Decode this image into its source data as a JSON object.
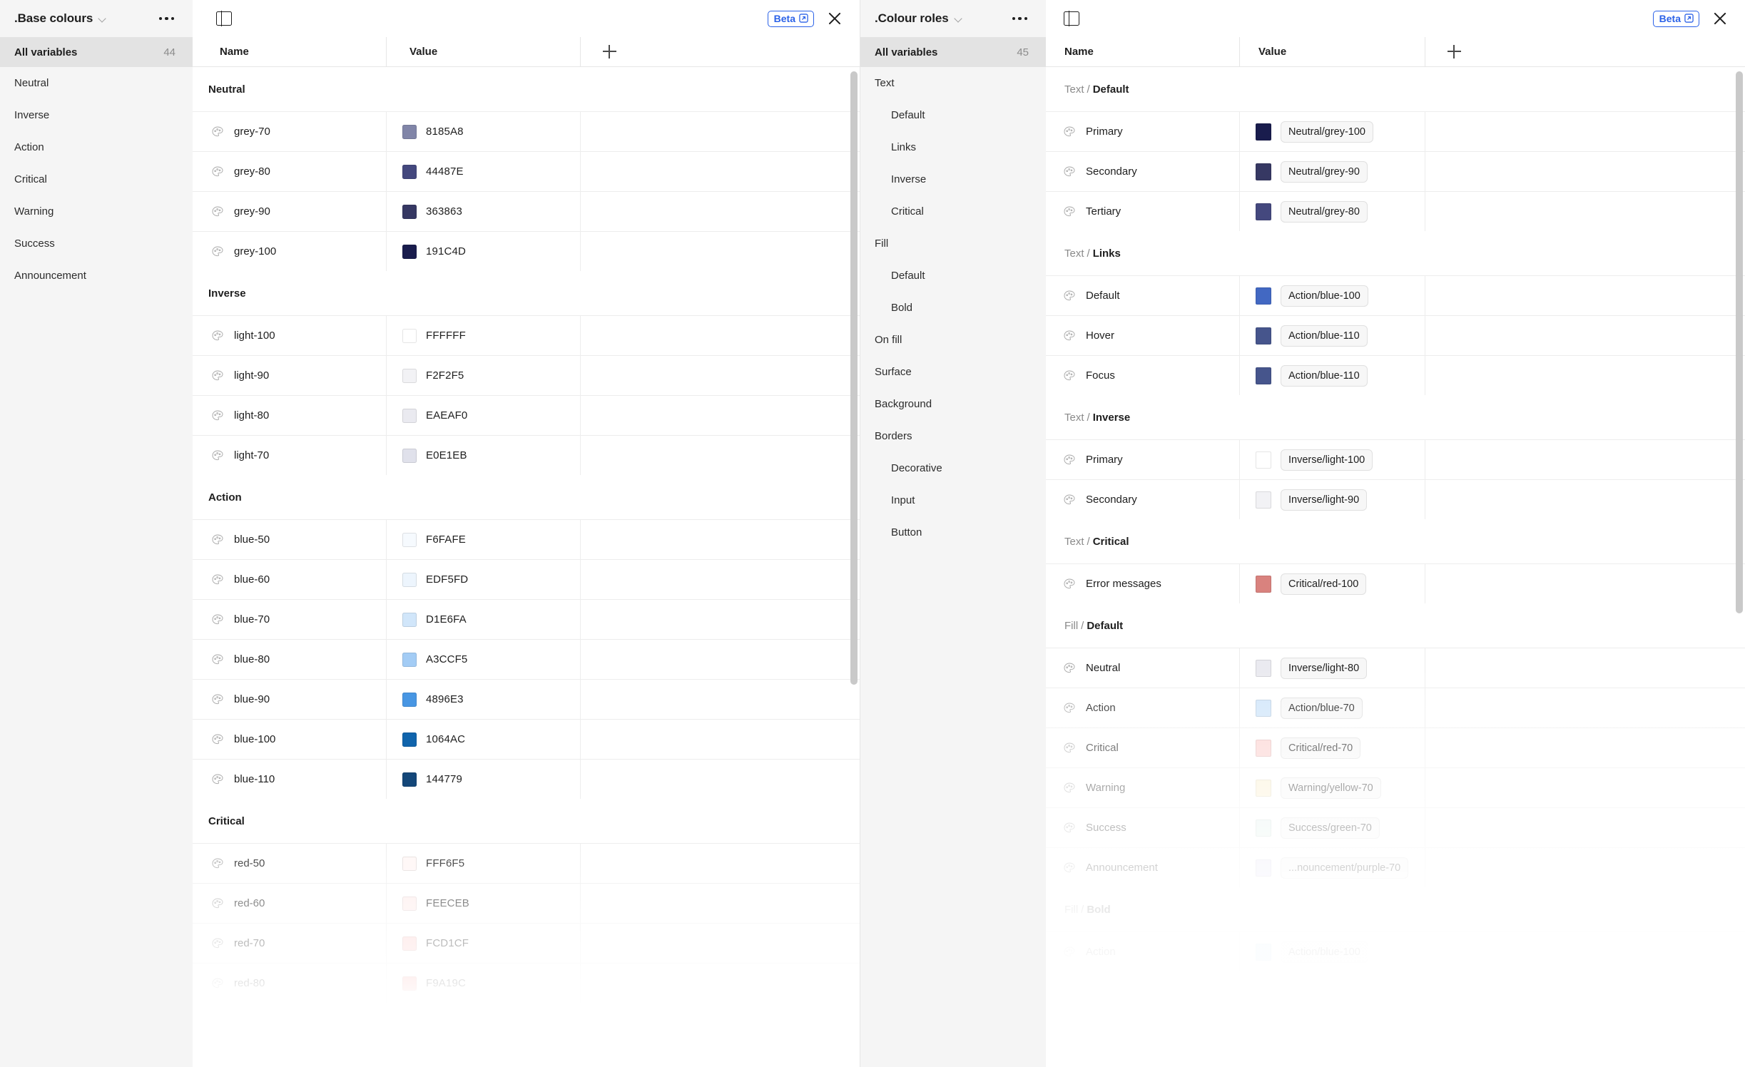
{
  "left_panel": {
    "titlebar": {
      "collection_name": ".Base colours",
      "chevron_icon": "chevron-down-icon",
      "more_icon": "more-options-icon",
      "panel_toggle_icon": "panel-layout-icon",
      "beta_label": "Beta",
      "external_link_icon": "external-link-icon",
      "close_icon": "close-icon"
    },
    "sidebar": {
      "all_variables_label": "All variables",
      "all_variables_count": "44",
      "items": [
        {
          "label": "Neutral"
        },
        {
          "label": "Inverse"
        },
        {
          "label": "Action"
        },
        {
          "label": "Critical"
        },
        {
          "label": "Warning"
        },
        {
          "label": "Success"
        },
        {
          "label": "Announcement"
        }
      ]
    },
    "table": {
      "columns": {
        "name": "Name",
        "value": "Value",
        "add_icon": "plus-icon"
      },
      "groups": [
        {
          "title": "Neutral",
          "rows": [
            {
              "icon": "palette-icon",
              "name": "grey-70",
              "value": "8185A8",
              "color": "#8185A8"
            },
            {
              "icon": "palette-icon",
              "name": "grey-80",
              "value": "44487E",
              "color": "#44487E"
            },
            {
              "icon": "palette-icon",
              "name": "grey-90",
              "value": "363863",
              "color": "#363863"
            },
            {
              "icon": "palette-icon",
              "name": "grey-100",
              "value": "191C4D",
              "color": "#191C4D"
            }
          ]
        },
        {
          "title": "Inverse",
          "rows": [
            {
              "icon": "palette-icon",
              "name": "light-100",
              "value": "FFFFFF",
              "color": "#FFFFFF"
            },
            {
              "icon": "palette-icon",
              "name": "light-90",
              "value": "F2F2F5",
              "color": "#F2F2F5"
            },
            {
              "icon": "palette-icon",
              "name": "light-80",
              "value": "EAEAF0",
              "color": "#EAEAF0"
            },
            {
              "icon": "palette-icon",
              "name": "light-70",
              "value": "E0E1EB",
              "color": "#E0E1EB"
            }
          ]
        },
        {
          "title": "Action",
          "rows": [
            {
              "icon": "palette-icon",
              "name": "blue-50",
              "value": "F6FAFE",
              "color": "#F6FAFE"
            },
            {
              "icon": "palette-icon",
              "name": "blue-60",
              "value": "EDF5FD",
              "color": "#EDF5FD"
            },
            {
              "icon": "palette-icon",
              "name": "blue-70",
              "value": "D1E6FA",
              "color": "#D1E6FA"
            },
            {
              "icon": "palette-icon",
              "name": "blue-80",
              "value": "A3CCF5",
              "color": "#A3CCF5"
            },
            {
              "icon": "palette-icon",
              "name": "blue-90",
              "value": "4896E3",
              "color": "#4896E3"
            },
            {
              "icon": "palette-icon",
              "name": "blue-100",
              "value": "1064AC",
              "color": "#1064AC"
            },
            {
              "icon": "palette-icon",
              "name": "blue-110",
              "value": "144779",
              "color": "#144779"
            }
          ]
        },
        {
          "title": "Critical",
          "rows": [
            {
              "icon": "palette-icon",
              "name": "red-50",
              "value": "FFF6F5",
              "color": "#FFF6F5"
            },
            {
              "icon": "palette-icon",
              "name": "red-60",
              "value": "FEECEB",
              "color": "#FEECEB"
            },
            {
              "icon": "palette-icon",
              "name": "red-70",
              "value": "FCD1CF",
              "color": "#FCD1CF"
            },
            {
              "icon": "palette-icon",
              "name": "red-80",
              "value": "F9A19C",
              "color": "#F9A19C"
            }
          ]
        }
      ]
    }
  },
  "right_panel": {
    "titlebar": {
      "collection_name": ".Colour roles",
      "chevron_icon": "chevron-down-icon",
      "more_icon": "more-options-icon",
      "panel_toggle_icon": "panel-layout-icon",
      "beta_label": "Beta",
      "external_link_icon": "external-link-icon",
      "close_icon": "close-icon"
    },
    "sidebar": {
      "all_variables_label": "All variables",
      "all_variables_count": "45",
      "items": [
        {
          "label": "Text",
          "indent": false
        },
        {
          "label": "Default",
          "indent": true
        },
        {
          "label": "Links",
          "indent": true
        },
        {
          "label": "Inverse",
          "indent": true
        },
        {
          "label": "Critical",
          "indent": true
        },
        {
          "label": "Fill",
          "indent": false
        },
        {
          "label": "Default",
          "indent": true
        },
        {
          "label": "Bold",
          "indent": true
        },
        {
          "label": "On fill",
          "indent": false
        },
        {
          "label": "Surface",
          "indent": false
        },
        {
          "label": "Background",
          "indent": false
        },
        {
          "label": "Borders",
          "indent": false
        },
        {
          "label": "Decorative",
          "indent": true
        },
        {
          "label": "Input",
          "indent": true
        },
        {
          "label": "Button",
          "indent": true
        }
      ]
    },
    "table": {
      "columns": {
        "name": "Name",
        "value": "Value",
        "add_icon": "plus-icon"
      },
      "groups": [
        {
          "prefix": "Text",
          "separator": "/",
          "title": "Default",
          "rows": [
            {
              "icon": "palette-icon",
              "name": "Primary",
              "alias": "Neutral/grey-100",
              "color": "#191C4D"
            },
            {
              "icon": "palette-icon",
              "name": "Secondary",
              "alias": "Neutral/grey-90",
              "color": "#363863"
            },
            {
              "icon": "palette-icon",
              "name": "Tertiary",
              "alias": "Neutral/grey-80",
              "color": "#44487E"
            }
          ]
        },
        {
          "prefix": "Text",
          "separator": "/",
          "title": "Links",
          "rows": [
            {
              "icon": "palette-icon",
              "name": "Default",
              "alias": "Action/blue-100",
              "color": "#4268C2"
            },
            {
              "icon": "palette-icon",
              "name": "Hover",
              "alias": "Action/blue-110",
              "color": "#46558C"
            },
            {
              "icon": "palette-icon",
              "name": "Focus",
              "alias": "Action/blue-110",
              "color": "#46558C"
            }
          ]
        },
        {
          "prefix": "Text",
          "separator": "/",
          "title": "Inverse",
          "rows": [
            {
              "icon": "palette-icon",
              "name": "Primary",
              "alias": "Inverse/light-100",
              "color": "#FFFFFF"
            },
            {
              "icon": "palette-icon",
              "name": "Secondary",
              "alias": "Inverse/light-90",
              "color": "#F2F2F5"
            }
          ]
        },
        {
          "prefix": "Text",
          "separator": "/",
          "title": "Critical",
          "rows": [
            {
              "icon": "palette-icon",
              "name": "Error messages",
              "alias": "Critical/red-100",
              "color": "#D9827E"
            }
          ]
        },
        {
          "prefix": "Fill",
          "separator": "/",
          "title": "Default",
          "rows": [
            {
              "icon": "palette-icon",
              "name": "Neutral",
              "alias": "Inverse/light-80",
              "color": "#EAEAF0"
            },
            {
              "icon": "palette-icon",
              "name": "Action",
              "alias": "Action/blue-70",
              "color": "#D1E6FA"
            },
            {
              "icon": "palette-icon",
              "name": "Critical",
              "alias": "Critical/red-70",
              "color": "#FCD1CF"
            },
            {
              "icon": "palette-icon",
              "name": "Warning",
              "alias": "Warning/yellow-70",
              "color": "#FBF0CF"
            },
            {
              "icon": "palette-icon",
              "name": "Success",
              "alias": "Success/green-70",
              "color": "#E4F3EE"
            },
            {
              "icon": "palette-icon",
              "name": "Announcement",
              "alias": "...nouncement/purple-70",
              "color": "#E7E4F7"
            }
          ]
        },
        {
          "prefix": "Fill",
          "separator": "/",
          "title": "Bold",
          "rows": [
            {
              "icon": "palette-icon",
              "name": "Action",
              "alias": "Action/blue-100",
              "color": "#A3CCF5"
            }
          ]
        }
      ]
    }
  }
}
